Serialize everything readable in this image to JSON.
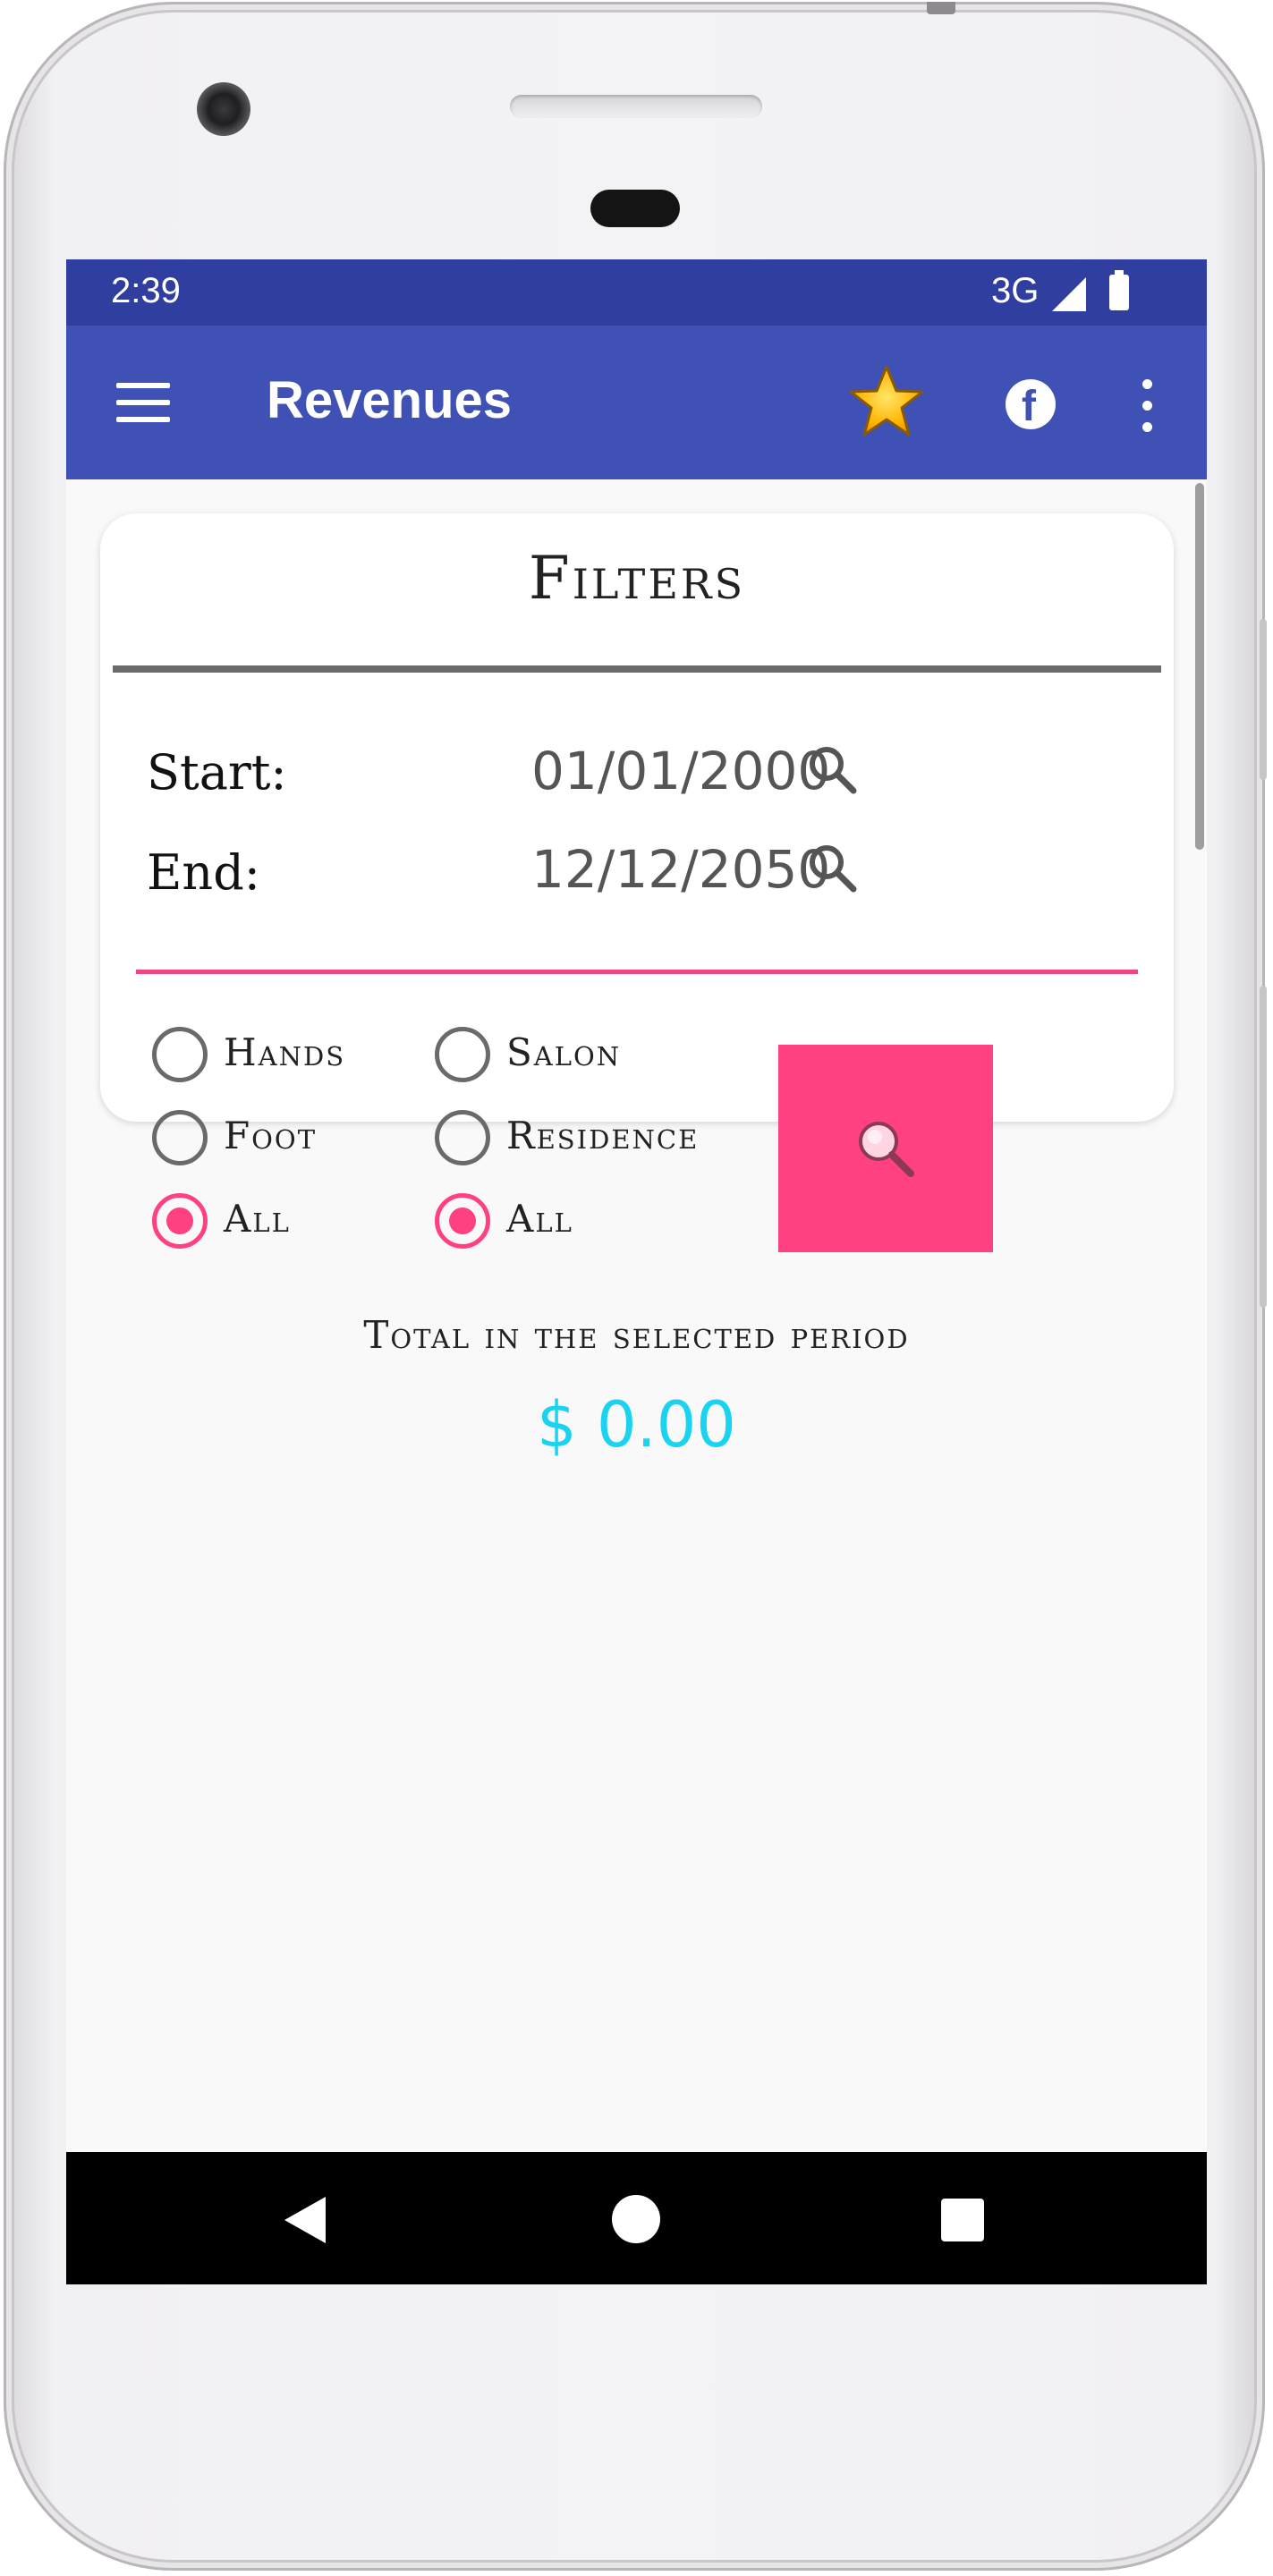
{
  "status_bar": {
    "time": "2:39",
    "network": "3G"
  },
  "app_bar": {
    "title": "Revenues",
    "icons": [
      "menu-icon",
      "star-icon",
      "facebook-icon",
      "more-vert-icon"
    ]
  },
  "filters": {
    "title": "Filters",
    "start_label": "Start:",
    "start_date": "01/01/2000",
    "end_label": "End:",
    "end_date": "12/12/2050",
    "service_options": [
      {
        "label": "Hands",
        "selected": false
      },
      {
        "label": "Foot",
        "selected": false
      },
      {
        "label": "All",
        "selected": true
      }
    ],
    "location_options": [
      {
        "label": "Salon",
        "selected": false
      },
      {
        "label": "Residence",
        "selected": false
      },
      {
        "label": "All",
        "selected": true
      }
    ]
  },
  "summary": {
    "label": "Total in the selected period",
    "value": "$ 0.00"
  },
  "colors": {
    "status_bar": "#303f9f",
    "app_bar": "#3f51b5",
    "accent": "#ff4081",
    "total": "#19d3f0"
  }
}
